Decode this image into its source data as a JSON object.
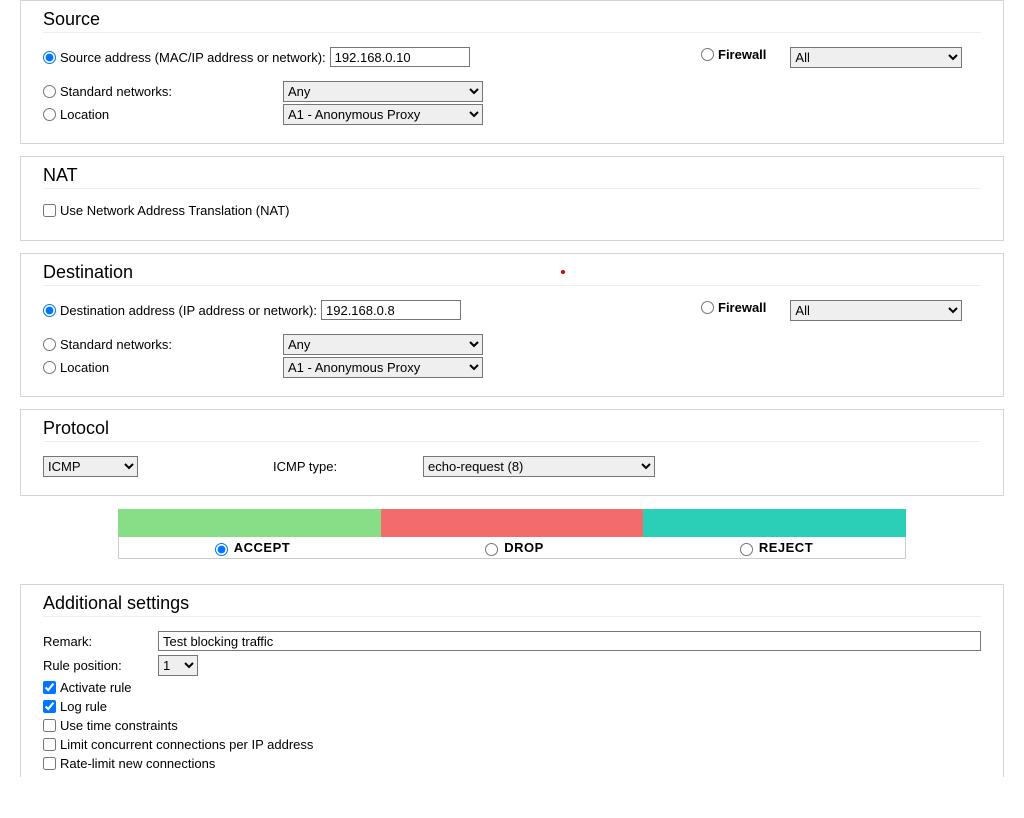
{
  "source": {
    "title": "Source",
    "addr_label": "Source address (MAC/IP address or network):",
    "addr_value": "192.168.0.10",
    "std_net_label": "Standard networks:",
    "std_net_value": "Any",
    "location_label": "Location",
    "location_value": "A1 - Anonymous Proxy",
    "firewall_label": "Firewall",
    "firewall_select": "All"
  },
  "nat": {
    "title": "NAT",
    "use_nat_label": "Use Network Address Translation (NAT)"
  },
  "destination": {
    "title": "Destination",
    "addr_label": "Destination address (IP address or network):",
    "addr_value": "192.168.0.8",
    "std_net_label": "Standard networks:",
    "std_net_value": "Any",
    "location_label": "Location",
    "location_value": "A1 - Anonymous Proxy",
    "firewall_label": "Firewall",
    "firewall_select": "All"
  },
  "protocol": {
    "title": "Protocol",
    "value": "ICMP",
    "icmp_type_label": "ICMP type:",
    "icmp_type_value": "echo-request (8)"
  },
  "actions": {
    "accept": "ACCEPT",
    "drop": "DROP",
    "reject": "REJECT"
  },
  "additional": {
    "title": "Additional settings",
    "remark_label": "Remark:",
    "remark_value": "Test blocking traffic",
    "position_label": "Rule position:",
    "position_value": "1",
    "activate_label": "Activate rule",
    "log_label": "Log rule",
    "time_label": "Use time constraints",
    "limit_conn_label": "Limit concurrent connections per IP address",
    "rate_limit_label": "Rate-limit new connections"
  }
}
